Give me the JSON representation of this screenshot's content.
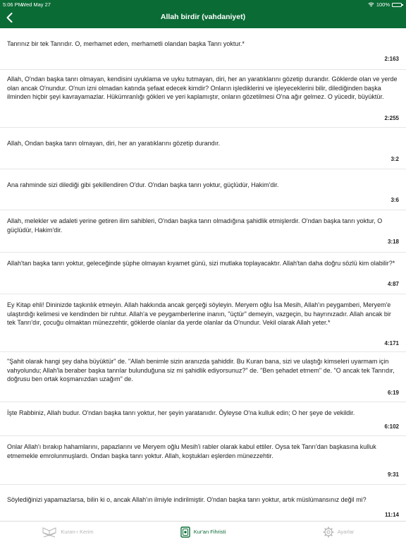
{
  "status": {
    "time": "5:06 PM",
    "date": "Wed May 27",
    "battery": "100%"
  },
  "header": {
    "title": "Allah birdir (vahdaniyet)"
  },
  "verses": [
    {
      "text": "Tanrınız bir tek Tanrıdır. O, merhamet eden, merhametli olandan başka Tanrı yoktur.*",
      "ref": "2:163"
    },
    {
      "text": "Allah, O'ndan başka tanrı olmayan, kendisini uyuklama ve uyku tutmayan, diri, her an yaratıklarını gözetip durandır. Göklerde olan ve yerde olan ancak O'nundur. O'nun izni olmadan katında şefaat edecek kimdir? Onların işlediklerini ve işleyeceklerini bilir, dilediğinden başka ilminden hiçbir şeyi kavrayamazlar. Hükümranlığı gökleri ve yeri kaplamıştır, onların gözetilmesi O'na ağır gelmez. O yücedir, büyüktür.",
      "ref": "2:255"
    },
    {
      "text": "Allah, Ondan başka tanrı olmayan, diri, her an yaratıklarını gözetip durandır.",
      "ref": "3:2"
    },
    {
      "text": "Ana rahminde sizi dilediği gibi şekillendiren O'dur. O'ndan başka tanrı yoktur, güçlüdür, Hakim'dir.",
      "ref": "3:6"
    },
    {
      "text": "Allah, melekler ve adaleti yerine getiren ilim sahibleri, O'ndan başka tanrı olmadığına şahidlik etmişlerdir. O'ndan başka tanrı yoktur, O güçlüdür, Hakim'dir.",
      "ref": "3:18"
    },
    {
      "text": "Allah'tan başka tanrı yoktur, geleceğinde şüphe olmayan kıyamet günü, sizi mutlaka toplayacaktır. Allah'tan daha doğru sözlü kim olabilir?*",
      "ref": "4:87"
    },
    {
      "text": "Ey Kitap ehli! Dininizde taşkınlık etmeyin. Allah hakkında ancak gerçeği söyleyin. Meryem oğlu İsa Mesih, Allah'ın peygamberi, Meryem'e ulaştırdığı kelimesi ve kendinden bir ruhtur. Allah'a ve peygamberlerine inanın, \"üçtür\" demeyin, vazgeçin, bu hayrınızadır. Allah ancak bir tek Tanrı'dır, çocuğu olmaktan münezzehtir, göklerde olanlar da yerde olanlar da O'nundur. Vekil olarak Allah yeter.*",
      "ref": "4:171"
    },
    {
      "text": "\"Şahit olarak hangi şey daha büyüktür\" de. \"Allah benimle sizin aranızda şahiddir. Bu Kuran bana, sizi ve ulaştığı kimseleri uyarmam için vahyolundu; Allah'la beraber başka tanrılar bulunduğuna siz mi şahidlik ediyorsunuz?\" de. \"Ben şehadet etmem\" de. \"O ancak tek Tanrıdır, doğrusu ben ortak koşmanızdan uzağım\" de.",
      "ref": "6:19"
    },
    {
      "text": "İşte Rabbiniz, Allah budur. O'ndan başka tanrı yoktur, her şeyin yaratanıdır. Öyleyse O'na kulluk edin; O her şeye de vekildir.",
      "ref": "6:102"
    },
    {
      "text": "Onlar Allah'ı bırakıp hahamlarını, papazlarını ve Meryem oğlu Mesih'i rabler olarak kabul ettiler. Oysa tek Tanrı'dan başkasına kulluk etmemekle emrolunmuşlardı. Ondan başka tanrı yoktur. Allah, koştukları eşlerden münezzehtir.",
      "ref": "9:31"
    },
    {
      "text": "Söylediğinizi yapamazlarsa, bilin ki o, ancak Allah'ın ilmiyle indirilmiştir. O'ndan başka tanrı yoktur, artık müslümansınız değil mi?",
      "ref": "11:14"
    }
  ],
  "tabs": [
    {
      "label": "Kuran-ı Kerim",
      "icon": "book-stand-icon",
      "active": false
    },
    {
      "label": "Kur'an Fihristi",
      "icon": "index-book-icon",
      "active": true
    },
    {
      "label": "Ayarlar",
      "icon": "gear-icon",
      "active": false
    }
  ],
  "colors": {
    "accent": "#0a6b35",
    "inactive_tab": "#b5b5b5"
  }
}
